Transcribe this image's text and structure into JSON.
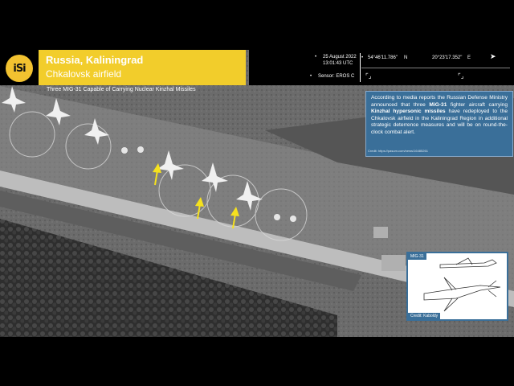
{
  "header": {
    "logo_text": "iSi",
    "title": "Russia, Kaliningrad",
    "subtitle": "Chkalovsk airfield",
    "caption": "Three MIG-31 Capable of Carrying Nuclear Kinzhal Missiles"
  },
  "info": {
    "date": "25 August 2022",
    "time": "13:01:43 UTC",
    "sensor": "Sensor: EROS C",
    "lat": "54°46'11.786\"",
    "lat_dir": "N",
    "lon": "20°23'17.352\"",
    "lon_dir": "E"
  },
  "description": {
    "part1": "According to media reports the Russian Defense Ministry announced that three ",
    "bold1": "MiG-31",
    "part2": " fighter aircraft carrying ",
    "bold2": "Kinzhal hypersonic missiles",
    "part3": " have redeployed to the Chkalovsk airfield in the Kaliningrad Region in additional strategic deterrence measures and will be on round-the-clock combat alert.",
    "credit": "Credit: https://pasum.com/news/16485261"
  },
  "inset": {
    "label": "MIG-31",
    "credit": "Credit: Kaboldy"
  },
  "colors": {
    "accent_yellow": "#f2cd2b",
    "panel_blue": "#3a6f99",
    "arrow_yellow": "#f5e11e"
  }
}
